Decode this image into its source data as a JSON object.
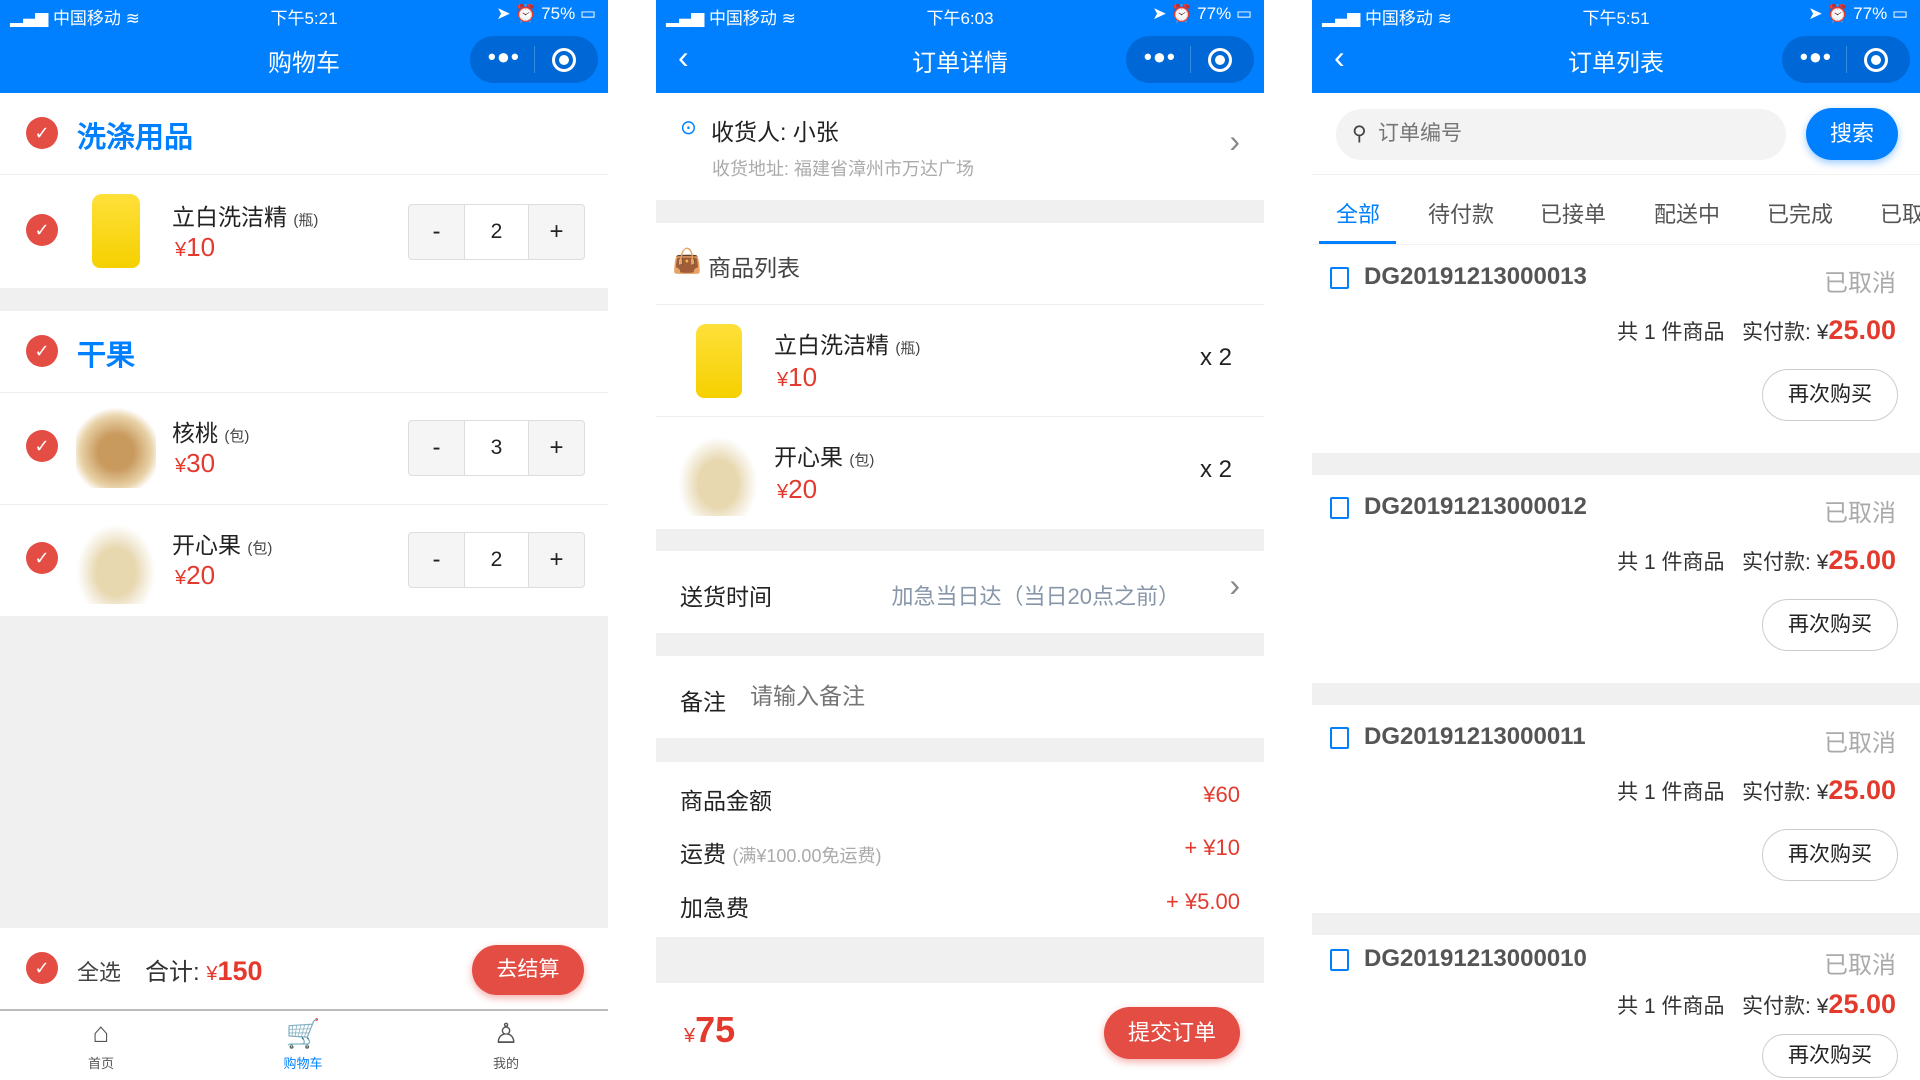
{
  "colors": {
    "primary": "#0080ff",
    "accent": "#e44d44",
    "price": "#e43a2e"
  },
  "cart": {
    "status": {
      "carrier": "中国移动",
      "time": "下午5:21",
      "battery": "75%"
    },
    "title": "购物车",
    "categories": [
      {
        "name": "洗涤用品",
        "items": [
          {
            "name": "立白洗洁精",
            "unit": "(瓶)",
            "currency": "¥",
            "price": "10",
            "qty": "2"
          }
        ]
      },
      {
        "name": "干果",
        "items": [
          {
            "name": "核桃",
            "unit": "(包)",
            "currency": "¥",
            "price": "30",
            "qty": "3"
          },
          {
            "name": "开心果",
            "unit": "(包)",
            "currency": "¥",
            "price": "20",
            "qty": "2"
          }
        ]
      }
    ],
    "select_all": "全选",
    "total_label": "合计:",
    "total_currency": "¥",
    "total": "150",
    "checkout": "去结算",
    "tabs": [
      {
        "label": "首页",
        "icon": "home-icon"
      },
      {
        "label": "购物车",
        "icon": "cart-icon",
        "active": true
      },
      {
        "label": "我的",
        "icon": "user-icon"
      }
    ]
  },
  "detail": {
    "status": {
      "carrier": "中国移动",
      "time": "下午6:03",
      "battery": "77%"
    },
    "title": "订单详情",
    "receiver": "收货人: 小张",
    "address": "收货地址: 福建省漳州市万达广场",
    "goods_header": "商品列表",
    "items": [
      {
        "name": "立白洗洁精",
        "unit": "(瓶)",
        "currency": "¥",
        "price": "10",
        "qty": "x 2"
      },
      {
        "name": "开心果",
        "unit": "(包)",
        "currency": "¥",
        "price": "20",
        "qty": "x 2"
      }
    ],
    "delivery_label": "送货时间",
    "delivery_value": "加急当日达（当日20点之前）",
    "note_label": "备注",
    "note_placeholder": "请输入备注",
    "goods_amount_label": "商品金额",
    "goods_amount": "¥60",
    "shipping_label": "运费",
    "shipping_note": "(满¥100.00免运费)",
    "shipping": "+ ¥10",
    "rush_label": "加急费",
    "rush": "+ ¥5.00",
    "total_currency": "¥",
    "total": "75",
    "submit": "提交订单"
  },
  "orders": {
    "status": {
      "carrier": "中国移动",
      "time": "下午5:51",
      "battery": "77%"
    },
    "title": "订单列表",
    "search_placeholder": "订单编号",
    "search_button": "搜索",
    "tabs": [
      "全部",
      "待付款",
      "已接单",
      "配送中",
      "已完成",
      "已取"
    ],
    "list": [
      {
        "id": "DG20191213000013",
        "status": "已取消",
        "count": "共 1 件商品",
        "paid_label": "实付款:",
        "currency": "¥",
        "amount": "25.00",
        "action": "再次购买"
      },
      {
        "id": "DG20191213000012",
        "status": "已取消",
        "count": "共 1 件商品",
        "paid_label": "实付款:",
        "currency": "¥",
        "amount": "25.00",
        "action": "再次购买"
      },
      {
        "id": "DG20191213000011",
        "status": "已取消",
        "count": "共 1 件商品",
        "paid_label": "实付款:",
        "currency": "¥",
        "amount": "25.00",
        "action": "再次购买"
      },
      {
        "id": "DG20191213000010",
        "status": "已取消",
        "count": "共 1 件商品",
        "paid_label": "实付款:",
        "currency": "¥",
        "amount": "25.00",
        "action": "再次购买"
      }
    ]
  }
}
